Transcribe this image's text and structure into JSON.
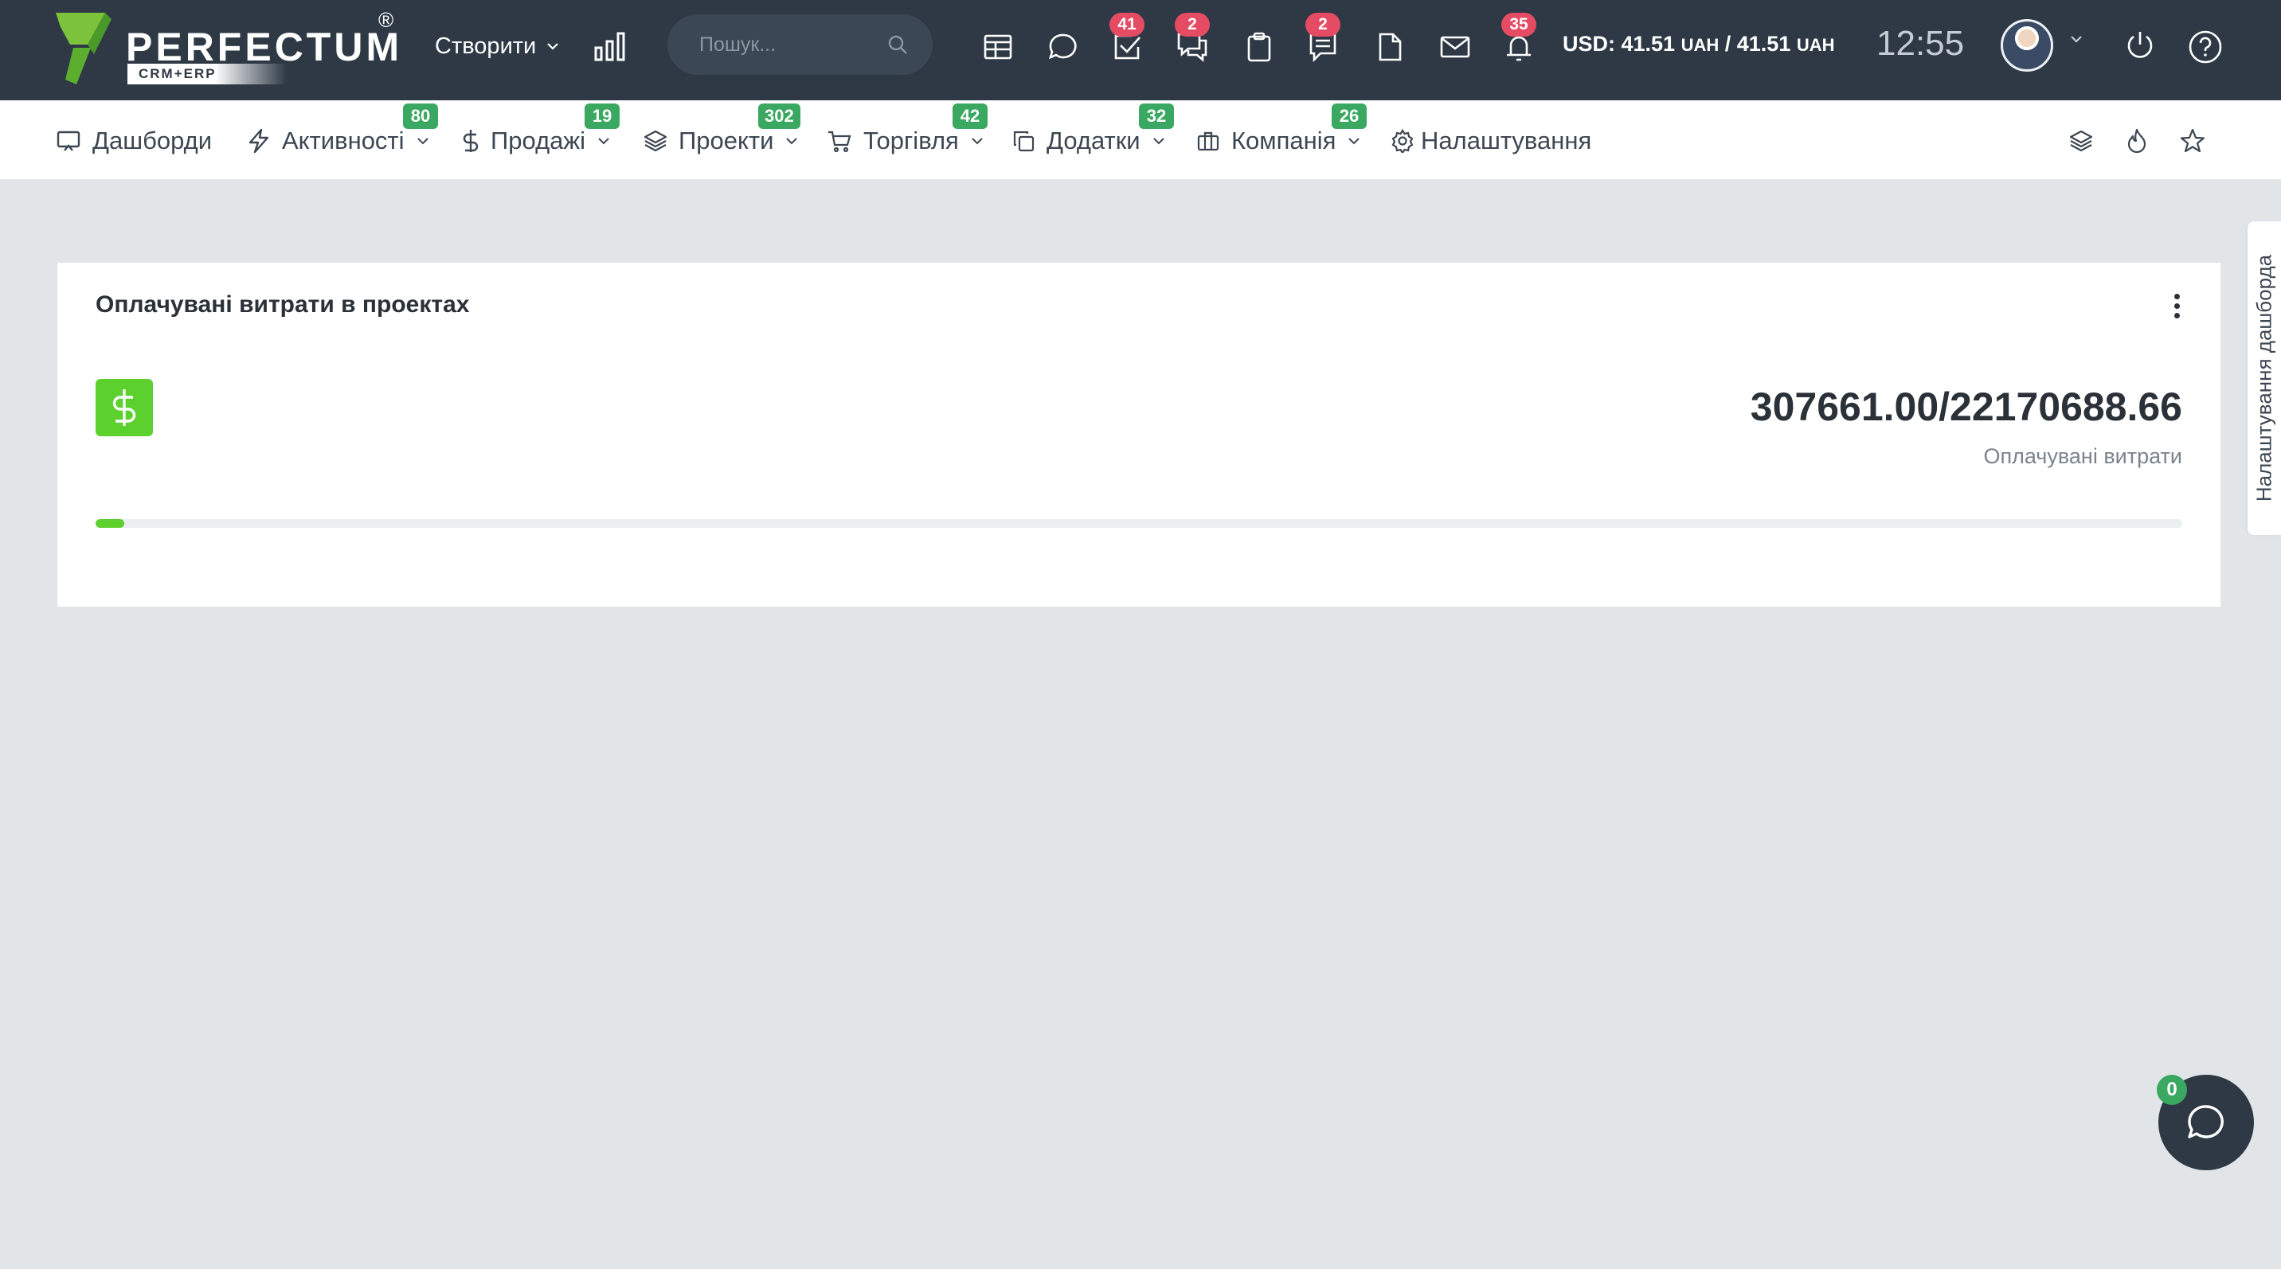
{
  "brand": {
    "name": "PERFECTUM",
    "sub": "CRM+ERP",
    "reg": "®"
  },
  "topbar": {
    "create_label": "Створити",
    "search_placeholder": "Пошук...",
    "badges": {
      "tasks": "41",
      "discussions": "2",
      "tickets": "2",
      "notifications": "35"
    },
    "currency": {
      "text": "USD: 41.51",
      "unit1": "UAH",
      "sep": " / 41.51 ",
      "unit2": "UAH"
    },
    "clock": "12:55"
  },
  "nav": {
    "items": [
      {
        "label": "Дашборди",
        "badge": ""
      },
      {
        "label": "Активності",
        "badge": "80"
      },
      {
        "label": "Продажі",
        "badge": "19"
      },
      {
        "label": "Проекти",
        "badge": "302"
      },
      {
        "label": "Торгівля",
        "badge": "42"
      },
      {
        "label": "Додатки",
        "badge": "32"
      },
      {
        "label": "Компанія",
        "badge": "26"
      },
      {
        "label": "Налаштування",
        "badge": ""
      }
    ]
  },
  "widget": {
    "title": "Оплачувані витрати в проектах",
    "value": "307661.00/22170688.66",
    "label": "Оплачувані витрати",
    "progress_percent": 1.39
  },
  "side_tab": {
    "label": "Налаштування дашборда"
  },
  "chat": {
    "badge": "0"
  },
  "colors": {
    "topbar": "#2e3945",
    "accent_green": "#5cd12e",
    "badge_green": "#3aa861",
    "badge_red": "#e54c63"
  },
  "icons": {
    "topbar": [
      "stats-icon",
      "search-icon",
      "calendar-icon",
      "chat-icon",
      "tasks-icon",
      "discussions-icon",
      "clipboard-icon",
      "tickets-icon",
      "file-icon",
      "mail-icon",
      "bell-icon",
      "power-icon",
      "help-icon"
    ],
    "nav_right": [
      "layers-icon",
      "fire-icon",
      "star-icon"
    ]
  }
}
